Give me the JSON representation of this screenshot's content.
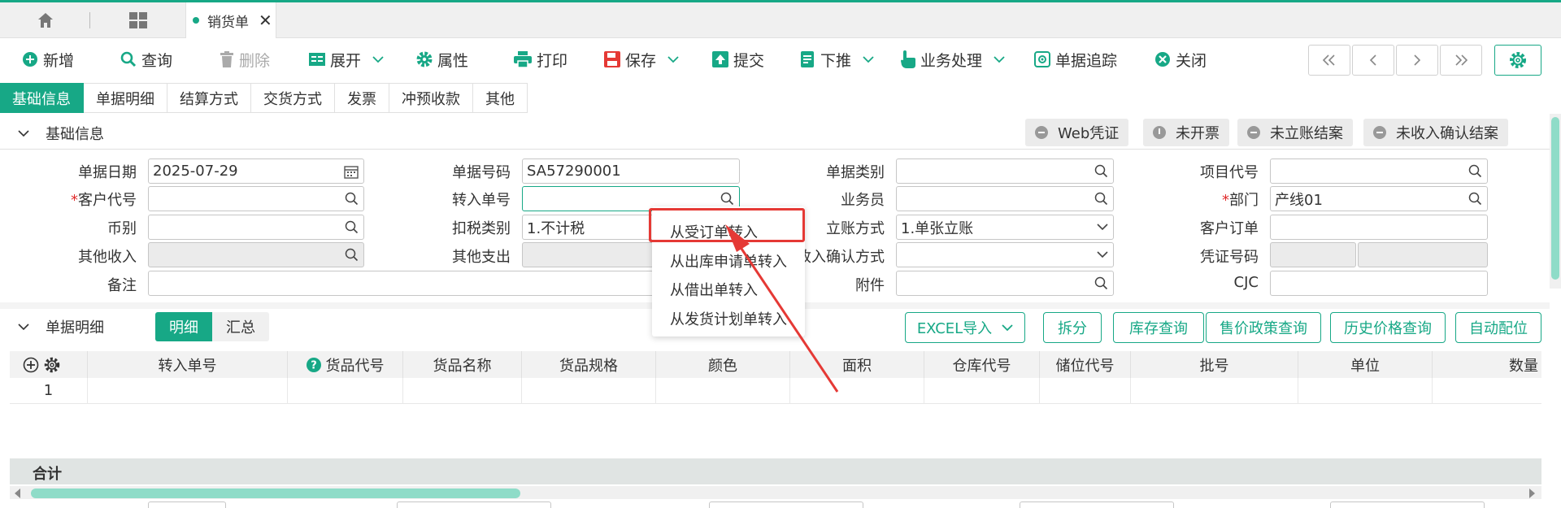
{
  "tab": {
    "title": "销货单",
    "close": "✕"
  },
  "toolbar": [
    {
      "label": "新增",
      "icon": "plus-circle-icon"
    },
    {
      "label": "查询",
      "icon": "search-icon"
    },
    {
      "label": "删除",
      "icon": "trash-icon",
      "disabled": true
    },
    {
      "label": "展开",
      "icon": "expand-icon"
    },
    {
      "label": "属性",
      "icon": "gear-icon"
    },
    {
      "label": "打印",
      "icon": "printer-icon"
    },
    {
      "label": "保存",
      "icon": "save-icon"
    },
    {
      "label": "提交",
      "icon": "upload-icon"
    },
    {
      "label": "下推",
      "icon": "document-icon"
    },
    {
      "label": "业务处理",
      "icon": "hand-pointer-icon"
    },
    {
      "label": "单据追踪",
      "icon": "target-icon"
    },
    {
      "label": "关闭",
      "icon": "close-circle-icon"
    }
  ],
  "subtabs": [
    "基础信息",
    "单据明细",
    "结算方式",
    "交货方式",
    "发票",
    "冲预收款",
    "其他"
  ],
  "basic_section": {
    "title": "基础信息",
    "status_pills": [
      "Web凭证",
      "未开票",
      "未立账结案",
      "未收入确认结案"
    ]
  },
  "form": {
    "date_label": "单据日期",
    "date_value": "2025-07-29",
    "docno_label": "单据号码",
    "docno_value": "SA57290001",
    "doctype_label": "单据类别",
    "project_label": "项目代号",
    "customer_label": "客户代号",
    "transfer_label": "转入单号",
    "salesman_label": "业务员",
    "dept_label": "部门",
    "dept_value": "产线01",
    "currency_label": "币别",
    "tax_label": "扣税类别",
    "tax_value": "1.不计税",
    "account_label": "立账方式",
    "account_value": "1.单张立账",
    "custorder_label": "客户订单",
    "otherin_label": "其他收入",
    "otherout_label": "其他支出",
    "revenue_label": "收入确认方式",
    "voucher_label": "凭证号码",
    "remark_label": "备注",
    "attach_label": "附件",
    "cjc_label": "CJC",
    "required_mark": "*"
  },
  "popup_menu": [
    "从受订单转入",
    "从出库申请单转入",
    "从借出单转入",
    "从发货计划单转入"
  ],
  "detail_section": {
    "title": "单据明细",
    "toggle": [
      "明细",
      "汇总"
    ],
    "buttons": [
      "EXCEL导入",
      "拆分",
      "库存查询",
      "售价政策查询",
      "历史价格查询",
      "自动配位"
    ]
  },
  "grid": {
    "columns": [
      "转入单号",
      "货品代号",
      "货品名称",
      "货品规格",
      "颜色",
      "面积",
      "仓库代号",
      "储位代号",
      "批号",
      "单位",
      "数量"
    ],
    "row_number": "1",
    "total_label": "合计"
  },
  "colors": {
    "accent": "#17a886",
    "highlight": "#e53935"
  }
}
